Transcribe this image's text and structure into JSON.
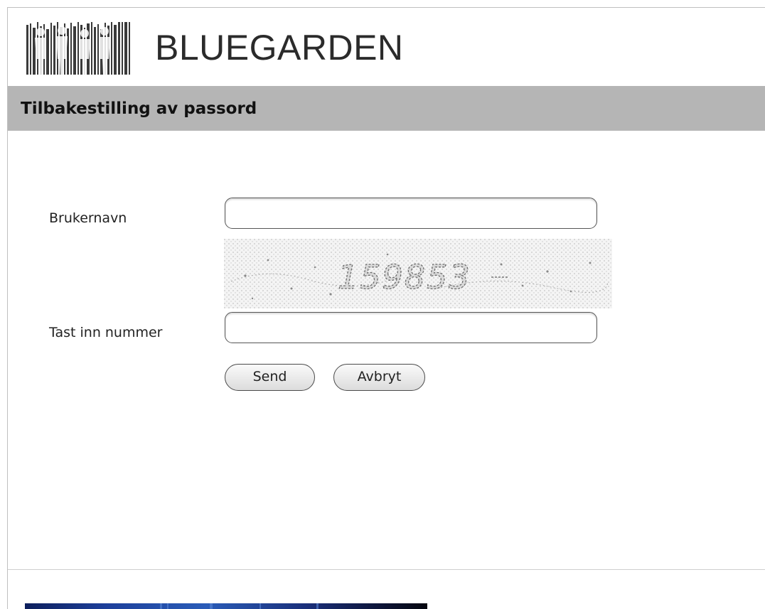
{
  "header": {
    "logo_icon": "barcode-people-logo-icon",
    "brand_name": "BLUEGARDEN"
  },
  "page": {
    "title": "Tilbakestilling av passord"
  },
  "form": {
    "username_label": "Brukernavn",
    "username_value": "",
    "captcha_code": "159853",
    "captcha_input_label": "Tast inn nummer",
    "captcha_input_value": "",
    "send_label": "Send",
    "cancel_label": "Avbryt"
  },
  "footer": {
    "banner_icon": "blue-banner-image"
  },
  "colors": {
    "title_bar": "#b5b5b5",
    "brand_text": "#2b2b2b",
    "banner_blue": "#1b2f7a"
  }
}
